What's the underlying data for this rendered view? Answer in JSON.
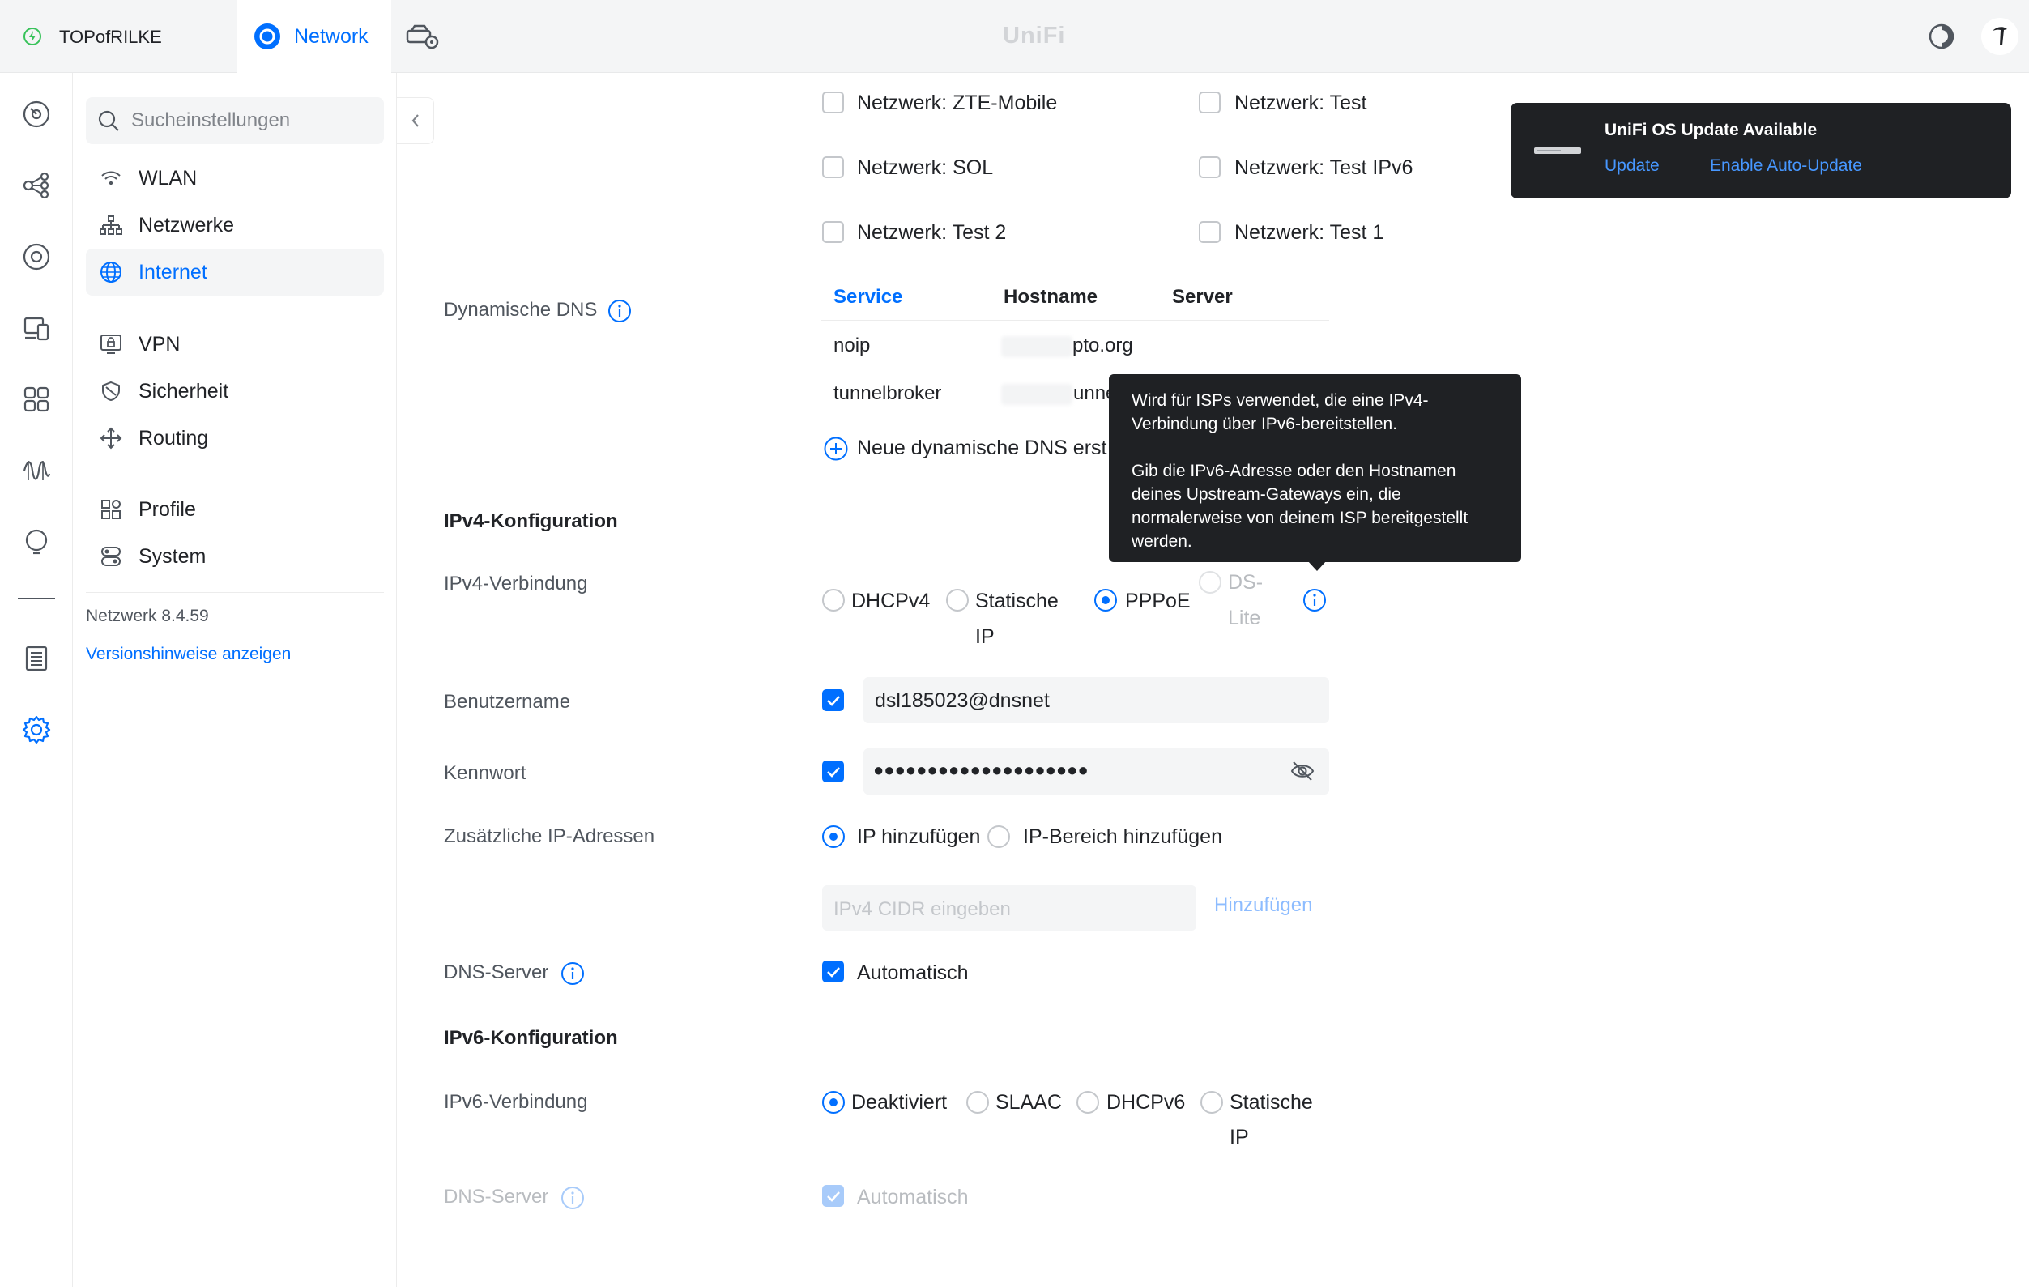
{
  "topbar": {
    "site_name": "TOPofRILKE",
    "app_tab": "Network",
    "brand": "UniFi"
  },
  "sidebar": {
    "search_placeholder": "Sucheinstellungen",
    "groups": [
      [
        {
          "label": "WLAN",
          "icon": "wifi-icon"
        },
        {
          "label": "Netzwerke",
          "icon": "network-tree-icon"
        },
        {
          "label": "Internet",
          "icon": "globe-icon",
          "active": true
        }
      ],
      [
        {
          "label": "VPN",
          "icon": "vpn-icon"
        },
        {
          "label": "Sicherheit",
          "icon": "shield-icon"
        },
        {
          "label": "Routing",
          "icon": "routing-icon"
        }
      ],
      [
        {
          "label": "Profile",
          "icon": "profiles-icon"
        },
        {
          "label": "System",
          "icon": "system-icon"
        }
      ]
    ],
    "version": "Netzwerk 8.4.59",
    "release_notes": "Versionshinweise anzeigen"
  },
  "networks": {
    "col1": [
      "Netzwerk: ZTE-Mobile",
      "Netzwerk: SOL",
      "Netzwerk: Test 2"
    ],
    "col2": [
      "Netzwerk: Test",
      "Netzwerk: Test IPv6",
      "Netzwerk: Test 1"
    ]
  },
  "dyndns": {
    "label": "Dynamische DNS",
    "columns": [
      "Service",
      "Hostname",
      "Server"
    ],
    "rows": [
      {
        "service": "noip",
        "hostname": "pto.org"
      },
      {
        "service": "tunnelbroker",
        "hostname": "unne"
      }
    ],
    "create_label": "Neue dynamische DNS erst"
  },
  "ipv4": {
    "section": "IPv4-Konfiguration",
    "connection_label": "IPv4-Verbindung",
    "options": [
      {
        "line1": "DHCPv4",
        "line2": ""
      },
      {
        "line1": "Statische",
        "line2": "IP"
      },
      {
        "line1": "PPPoE",
        "line2": ""
      },
      {
        "line1": "DS-",
        "line2": "Lite"
      }
    ],
    "selected": "PPPoE",
    "username_label": "Benutzername",
    "username_value": "dsl185023@dnsnet",
    "password_label": "Kennwort",
    "password_value": "●●●●●●●●●●●●●●●●●●●●",
    "extra_ip_label": "Zusätzliche IP-Adressen",
    "extra_ip_options": [
      "IP hinzufügen",
      "IP-Bereich hinzufügen"
    ],
    "cidr_placeholder": "IPv4 CIDR eingeben",
    "add_label": "Hinzufügen",
    "dns_label": "DNS-Server",
    "dns_auto": "Automatisch"
  },
  "ipv6": {
    "section": "IPv6-Konfiguration",
    "connection_label": "IPv6-Verbindung",
    "options": [
      {
        "line1": "Deaktiviert",
        "line2": ""
      },
      {
        "line1": "SLAAC",
        "line2": ""
      },
      {
        "line1": "DHCPv6",
        "line2": ""
      },
      {
        "line1": "Statische",
        "line2": "IP"
      }
    ],
    "selected": "Deaktiviert",
    "dns_label": "DNS-Server",
    "dns_auto": "Automatisch"
  },
  "tooltip": {
    "p1": "Wird für ISPs verwendet, die eine IPv4-Verbindung über IPv6-bereitstellen.",
    "p2": "Gib die IPv6-Adresse oder den Hostnamen deines Upstream-Gateways ein, die normalerweise von deinem ISP bereitgestellt werden."
  },
  "toast": {
    "title": "UniFi OS Update Available",
    "update": "Update",
    "auto_update": "Enable Auto-Update"
  },
  "colors": {
    "accent": "#006fff",
    "text": "#212327",
    "muted": "#50565e",
    "tooltip_bg": "#1f2124"
  }
}
